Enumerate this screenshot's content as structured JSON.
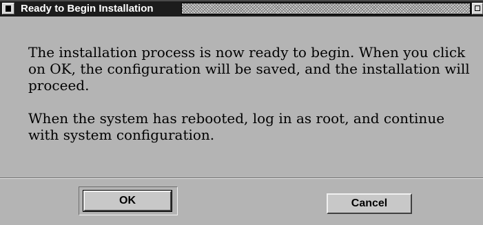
{
  "window": {
    "title": "Ready to Begin Installation"
  },
  "message": {
    "paragraph1": "The installation process is now ready to begin. When you click on OK, the configuration will be saved, and the installation will proceed.",
    "paragraph2": "When the system has rebooted, log in as root, and continue with system configuration."
  },
  "buttons": {
    "ok_label": "OK",
    "cancel_label": "Cancel"
  },
  "icons": {
    "window_menu": "window-menu-icon",
    "maximize": "maximize-icon"
  }
}
